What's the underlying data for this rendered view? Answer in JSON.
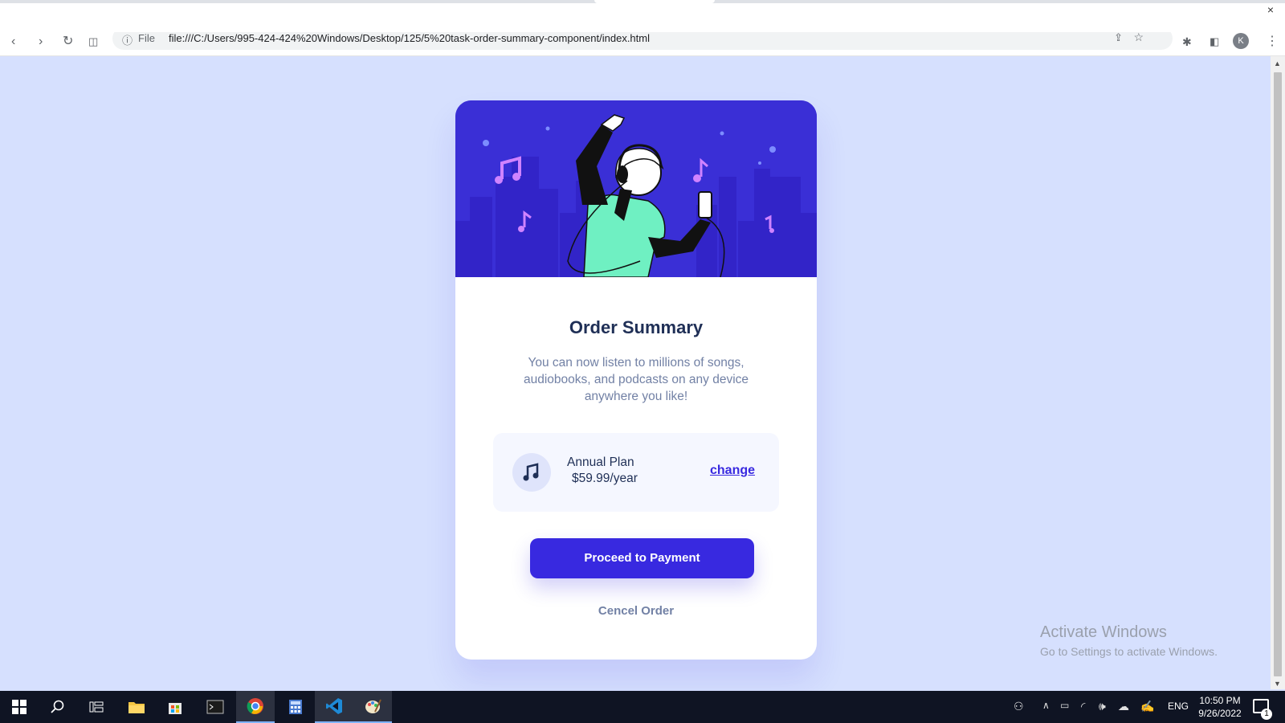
{
  "browser": {
    "scheme": "File",
    "url": "file:///C:/Users/995-424-424%20Windows/Desktop/125/5%20task-order-summary-component/index.html",
    "profile_initial": "K",
    "window_close": "×"
  },
  "card": {
    "title": "Order Summary",
    "description": "You can now listen to millions of songs, audiobooks, and podcasts on any device anywhere you like!",
    "plan": {
      "name": "Annual Plan",
      "price": "$59.99/year",
      "change_label": "change"
    },
    "pay_button": "Proceed to Payment",
    "cancel_label": "Cencel Order"
  },
  "watermark": {
    "title": "Activate Windows",
    "subtitle": "Go to Settings to activate Windows."
  },
  "taskbar": {
    "language": "ENG",
    "time": "10:50 PM",
    "date": "9/26/2022",
    "notification_count": "1"
  },
  "colors": {
    "page_background": "#d6e0fe",
    "primary": "#3829e0",
    "hero_background": "#3a2fd6",
    "title_text": "#1f2f56",
    "desc_text": "#7281a5"
  },
  "icons": [
    "back-icon",
    "forward-icon",
    "reload-icon",
    "home-icon",
    "info-icon",
    "share-icon",
    "star-icon",
    "extensions-icon",
    "sidepanel-icon",
    "menu-icon",
    "music-note-icon",
    "windows-start-icon",
    "search-icon",
    "task-view-icon",
    "file-explorer-icon",
    "store-icon",
    "terminal-icon",
    "chrome-icon",
    "calculator-icon",
    "vscode-icon",
    "paint-icon"
  ]
}
